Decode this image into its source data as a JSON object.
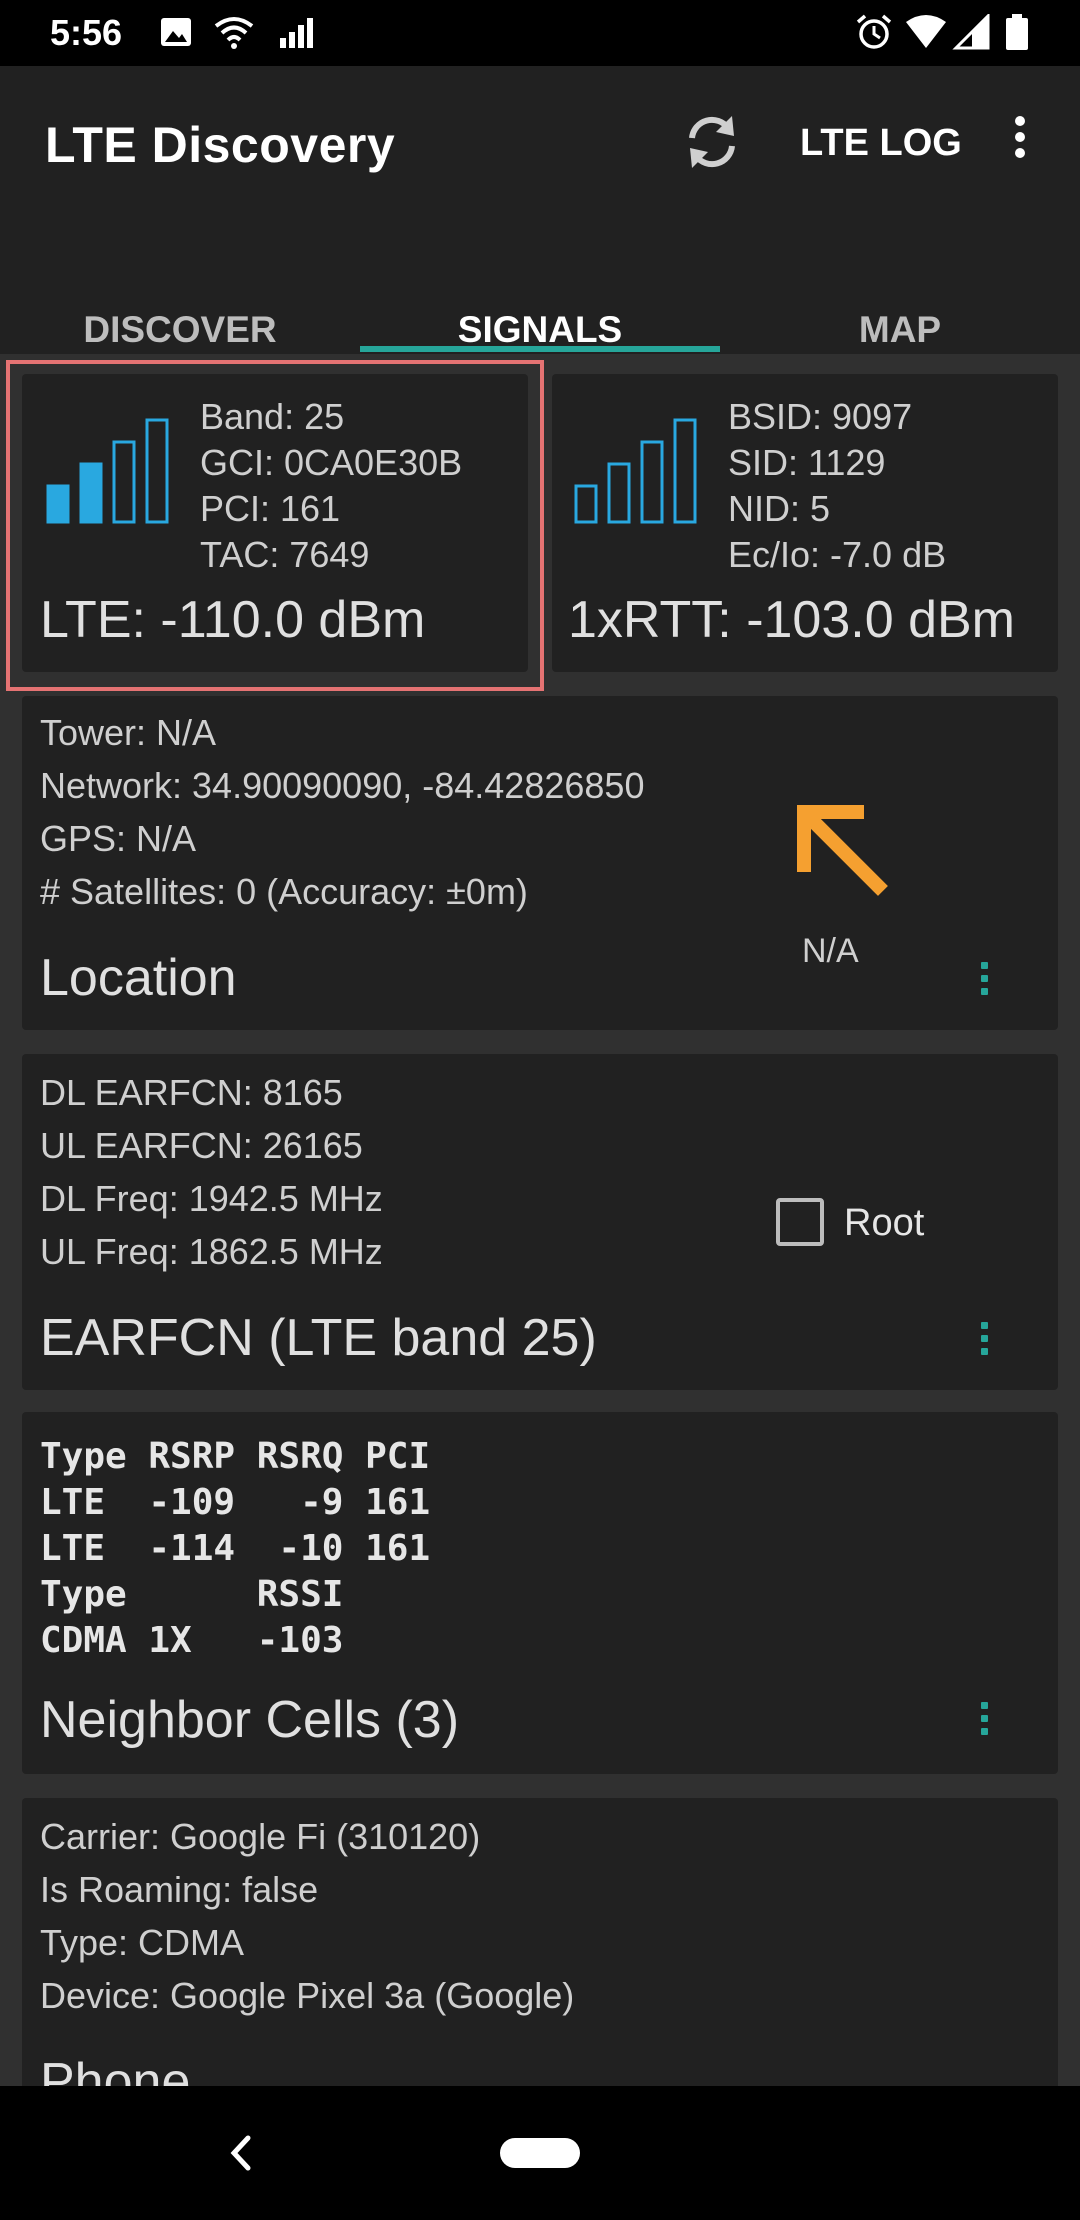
{
  "status_bar": {
    "time": "5:56",
    "icons": [
      "image-icon",
      "wifi-icon",
      "cell-signal-icon",
      "alarm-icon",
      "wifi-icon",
      "signal-icon",
      "battery-icon"
    ]
  },
  "app_bar": {
    "title": "LTE Discovery",
    "refresh_icon": "refresh-icon",
    "lte_log_label": "LTE LOG",
    "overflow_icon": "more-vert-icon"
  },
  "tabs": [
    {
      "label": "DISCOVER",
      "active": false
    },
    {
      "label": "SIGNALS",
      "active": true
    },
    {
      "label": "MAP",
      "active": false
    }
  ],
  "lte_card": {
    "band": "Band: 25",
    "gci": "GCI: 0CA0E30B",
    "pci": "PCI: 161",
    "tac": "TAC: 7649",
    "signal": "LTE: -110.0 dBm",
    "bars_filled": 2,
    "bars_total": 4
  },
  "rtt_card": {
    "bsid": "BSID: 9097",
    "sid": "SID: 1129",
    "nid": "NID: 5",
    "ecio": "Ec/Io: -7.0 dB",
    "signal": "1xRTT: -103.0 dBm",
    "bars_filled": 0,
    "bars_total": 4
  },
  "location_card": {
    "tower": "Tower: N/A",
    "network": "Network: 34.90090090, -84.42826850",
    "gps": "GPS: N/A",
    "satellites": "# Satellites: 0 (Accuracy: ±0m)",
    "title": "Location",
    "direction_label": "N/A",
    "arrow_color": "#f5a030"
  },
  "earfcn_card": {
    "dl_earfcn": "DL EARFCN: 8165",
    "ul_earfcn": "UL EARFCN: 26165",
    "dl_freq": "DL Freq: 1942.5 MHz",
    "ul_freq": "UL Freq: 1862.5 MHz",
    "root_label": "Root",
    "root_checked": false,
    "title": "EARFCN (LTE band 25)"
  },
  "neighbor_card": {
    "rows": [
      "Type RSRP RSRQ PCI",
      "LTE  -109   -9 161",
      "LTE  -114  -10 161",
      "Type      RSSI",
      "CDMA 1X   -103"
    ],
    "title": "Neighbor Cells (3)"
  },
  "phone_card": {
    "carrier": "Carrier: Google Fi (310120)",
    "roaming": "Is Roaming: false",
    "type": "Type: CDMA",
    "device": "Device: Google Pixel 3a (Google)",
    "title": "Phone"
  },
  "colors": {
    "accent": "#26a69a",
    "bar_blue": "#29a8e0",
    "highlight": "#e57373"
  }
}
